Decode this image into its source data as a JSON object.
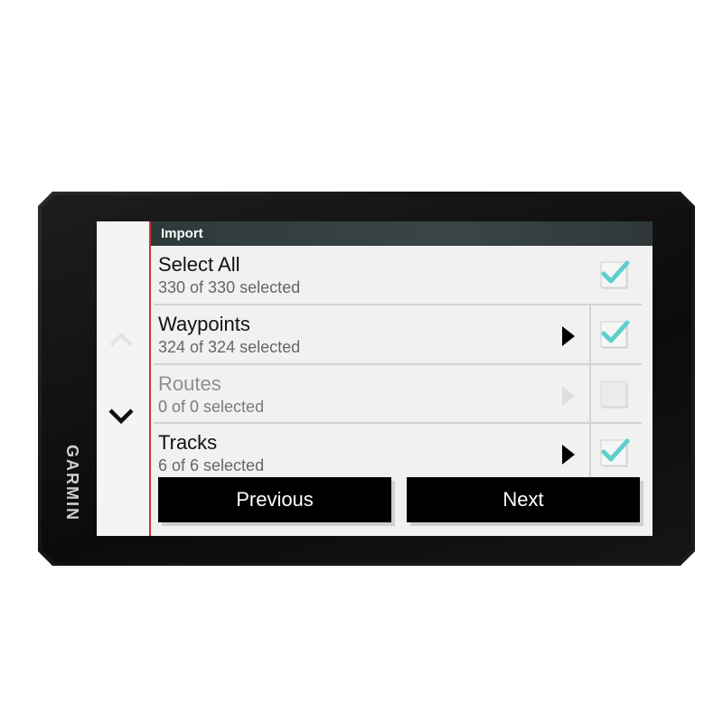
{
  "device": {
    "brand": "GARMIN"
  },
  "header": {
    "title": "Import"
  },
  "rows": [
    {
      "title": "Select All",
      "subtitle": "330 of 330 selected",
      "checked": true,
      "enabled": true,
      "has_arrow": false
    },
    {
      "title": "Waypoints",
      "subtitle": "324 of 324 selected",
      "checked": true,
      "enabled": true,
      "has_arrow": true
    },
    {
      "title": "Routes",
      "subtitle": "0 of 0 selected",
      "checked": false,
      "enabled": false,
      "has_arrow": true
    },
    {
      "title": "Tracks",
      "subtitle": "6 of 6 selected",
      "checked": true,
      "enabled": true,
      "has_arrow": true
    }
  ],
  "buttons": {
    "previous_label": "Previous",
    "next_label": "Next"
  },
  "colors": {
    "accent_check": "#5fcfcb",
    "header_bg": "#333e3e",
    "divider_red": "#c8323a",
    "button_bg": "#000000"
  },
  "icons": {
    "scroll_up": "chevron-up-icon",
    "scroll_down": "chevron-down-icon",
    "row_arrow": "triangle-right-icon",
    "checkbox": "checkbox-icon"
  }
}
